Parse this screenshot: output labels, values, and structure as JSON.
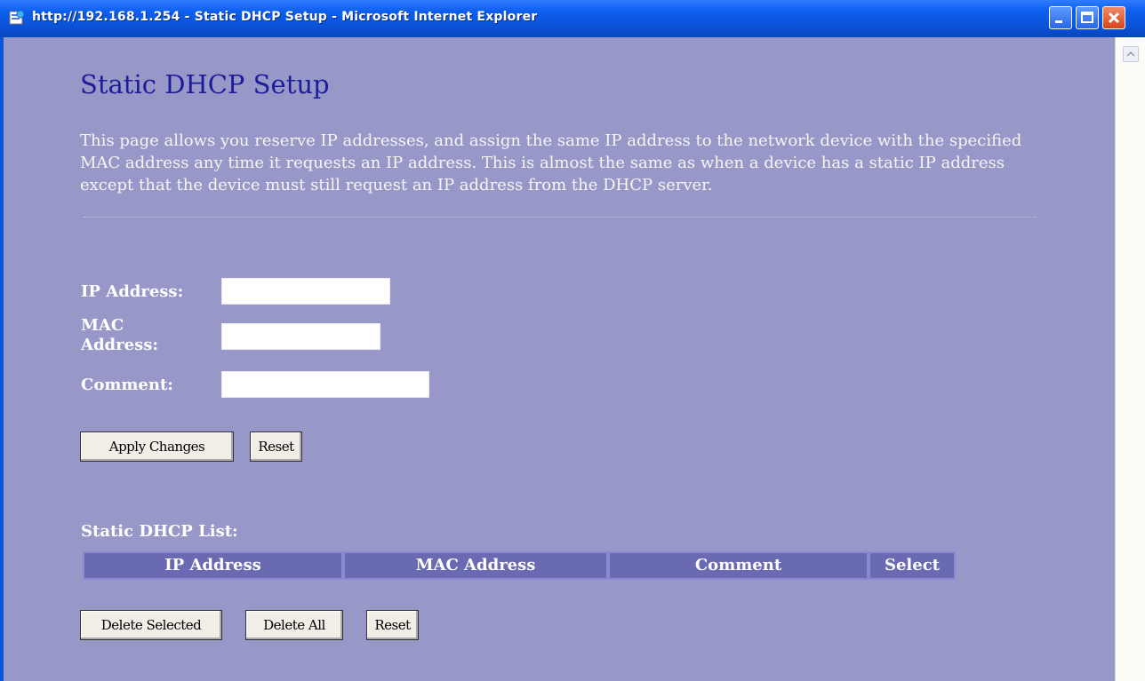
{
  "window": {
    "title": "http://192.168.1.254 - Static DHCP Setup - Microsoft Internet Explorer"
  },
  "page": {
    "heading": "Static DHCP Setup",
    "description": "This page allows you reserve IP addresses, and assign the same IP address to the network device with the specified MAC address any time it requests an IP address. This is almost the same as when a device has a static IP address except that the device must still request an IP address from the DHCP server."
  },
  "form": {
    "ip_label": "IP Address:",
    "ip_value": "",
    "mac_label": "MAC Address:",
    "mac_value": "",
    "comment_label": "Comment:",
    "comment_value": "",
    "apply_label": "Apply Changes",
    "reset_label": "Reset"
  },
  "list": {
    "title": "Static DHCP List:",
    "columns": [
      "IP Address",
      "MAC Address",
      "Comment",
      "Select"
    ],
    "rows": [],
    "delete_selected_label": "Delete Selected",
    "delete_all_label": "Delete All",
    "reset_label": "Reset"
  },
  "colors": {
    "titlebar": "#0a55d8",
    "page_bg": "#9898c8",
    "heading": "#1d1d9c",
    "header_cell": "#6a6ab2"
  }
}
